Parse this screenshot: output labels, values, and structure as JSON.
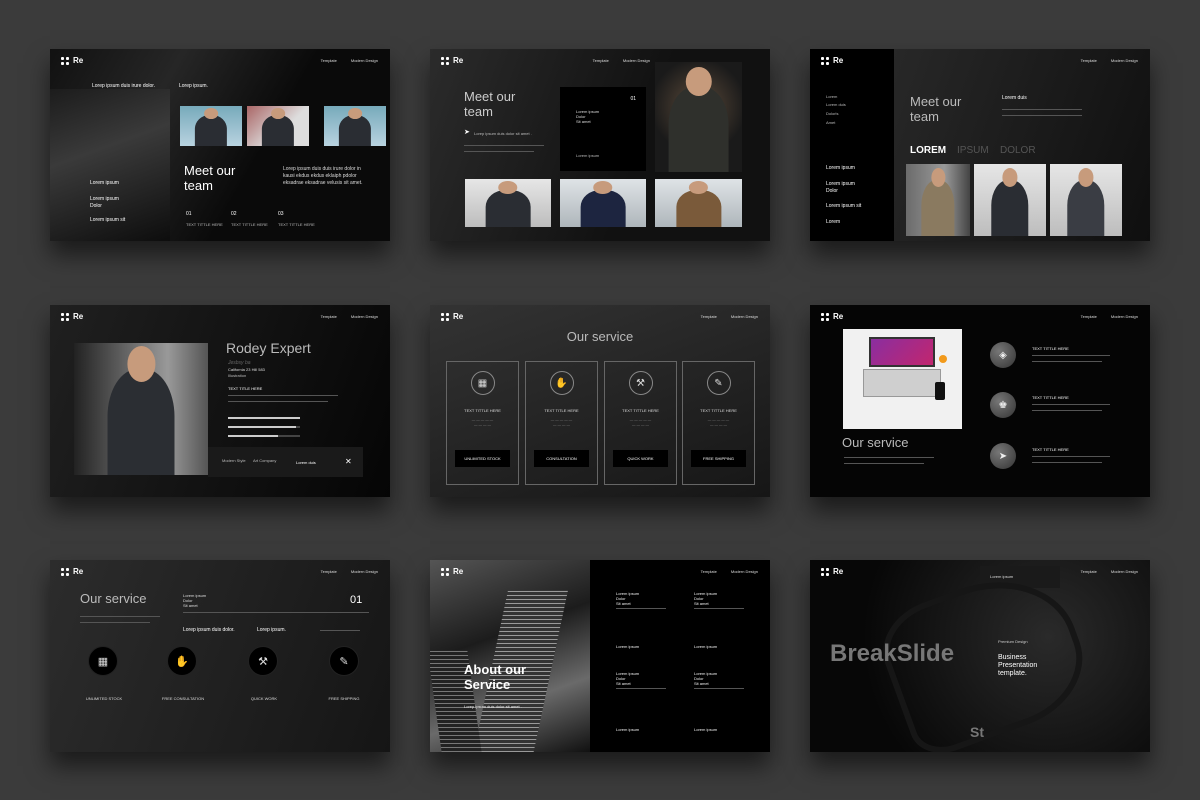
{
  "brand": "Re",
  "nav": {
    "template": "Template",
    "modern": "Modern Design"
  },
  "s1": {
    "lorem_top": "Lorep  ipsum duis irure dolor.",
    "lorem_top2": "Lorep  ipsum.",
    "title_l1": "Meet our",
    "title_l2": "team",
    "body": "Lorep  ipsum duis duis irure dolor in kausi ekdus ekdus eklaiph pdolor eksadrae eksadrae velusis sit amet.",
    "side": [
      "Lorem ipsum",
      "Lorem ipsum",
      "Dolor",
      "Lorem ipsum   sit"
    ],
    "nums": [
      "01",
      "02",
      "03"
    ],
    "num_label": "TEXT TITTLE HERE"
  },
  "s2": {
    "title_l1": "Meet our",
    "title_l2": "team",
    "body": "Lorep  ipsum duis dolor sit amet .",
    "num": "01",
    "box_text": [
      "Lorem ipsum",
      "Dolor",
      "Sit amet"
    ],
    "box_small": "Lorem ipsum"
  },
  "s3": {
    "side": [
      "Lorem",
      "Lorem duis",
      "Dolorls",
      "Amet"
    ],
    "side2": [
      "Lorem ipsum",
      "Lorem ipsum",
      "Dolor",
      "Lorem ipsum   sit",
      "Lorem"
    ],
    "title_l1": "Meet our",
    "title_l2": "team",
    "lorem_duis": "Lorem duis",
    "tabs": [
      "LOREM",
      "IPSUM",
      "DOLOR"
    ]
  },
  "s4": {
    "name": "Rodey Expert",
    "sub": "Jesbsy ba",
    "addr": "California 23 Hill 583",
    "misc": "Illustration",
    "label": "TEXT TITLE HERE",
    "f1": "Modern Style",
    "f2": "Art Company",
    "lorem": "Lorem duis",
    "close": "✕"
  },
  "s5": {
    "title": "Our service",
    "cards": [
      {
        "icon": "▦",
        "title": "TEXT TITTLE HERE",
        "btn": "UNLIMITED STOCK"
      },
      {
        "icon": "✋",
        "title": "TEXT TITLE HERE",
        "btn": "CONSULTATION"
      },
      {
        "icon": "⚒",
        "title": "TEXT TITTLE HERE",
        "btn": "QUICK WORK"
      },
      {
        "icon": "✎",
        "title": "TEXT TITTLE HERE",
        "btn": "FREE SHIPPING"
      }
    ]
  },
  "s6": {
    "title": "Our service",
    "items": [
      "TEXT TITTLE HERE",
      "TEXT TITTLE HERE",
      "TEXT TITTLE HERE"
    ]
  },
  "s7": {
    "title": "Our service",
    "mini": [
      "Lorem ipsum",
      "Dolor",
      "Sit amet"
    ],
    "num": "01",
    "mid": "Lorep  ipsum duis dolor.",
    "mid2": "Lorep  ipsum.",
    "steps": [
      "UNLIMITED STOCK",
      "FREE CONSULTATION",
      "QUICK WORK",
      "FREE SHIPPING"
    ]
  },
  "s8": {
    "title_l1": "About our",
    "title_l2": "Service",
    "body": "Lorep  ipsum duis dolor sit amet .",
    "blocks": [
      [
        "Lorem ipsum",
        "Dolor",
        "Sit amet"
      ],
      [
        "Lorem ipsum",
        "Dolor",
        "Sit amet"
      ],
      [
        "Lorem ipsum",
        "Dolor",
        "Sit amet"
      ],
      [
        "Lorem ipsum",
        "Dolor",
        "Sit amet"
      ]
    ],
    "small": "Lorem ipsum"
  },
  "s9": {
    "tag": "Lorem ipsum",
    "big": "BreakSlide",
    "st": "St",
    "premium": "Premium Design",
    "b1": "Business",
    "b2": "Presentation",
    "b3": "template."
  }
}
